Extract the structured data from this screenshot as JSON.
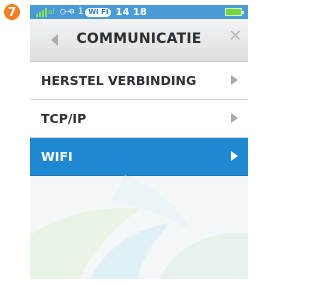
{
  "step": {
    "number": "7"
  },
  "statusbar": {
    "signal_label": "al",
    "key_text": "○—⊖ 1",
    "wifi_badge": "WI FI",
    "time": "14 18",
    "battery_level": 1.0
  },
  "titlebar": {
    "title": "COMMUNICATIE"
  },
  "menu": {
    "items": [
      {
        "label": "HERSTEL VERBINDING",
        "selected": false
      },
      {
        "label": "TCP/IP",
        "selected": false
      },
      {
        "label": "WIFI",
        "selected": true
      }
    ]
  },
  "colors": {
    "accent": "#1f88d3",
    "statusbar": "#4a9ad6",
    "step_badge": "#f07d1e",
    "battery": "#6fd63c"
  },
  "icons": {
    "back": "left-triangle-icon",
    "close": "close-icon",
    "chevron": "right-triangle-icon"
  }
}
